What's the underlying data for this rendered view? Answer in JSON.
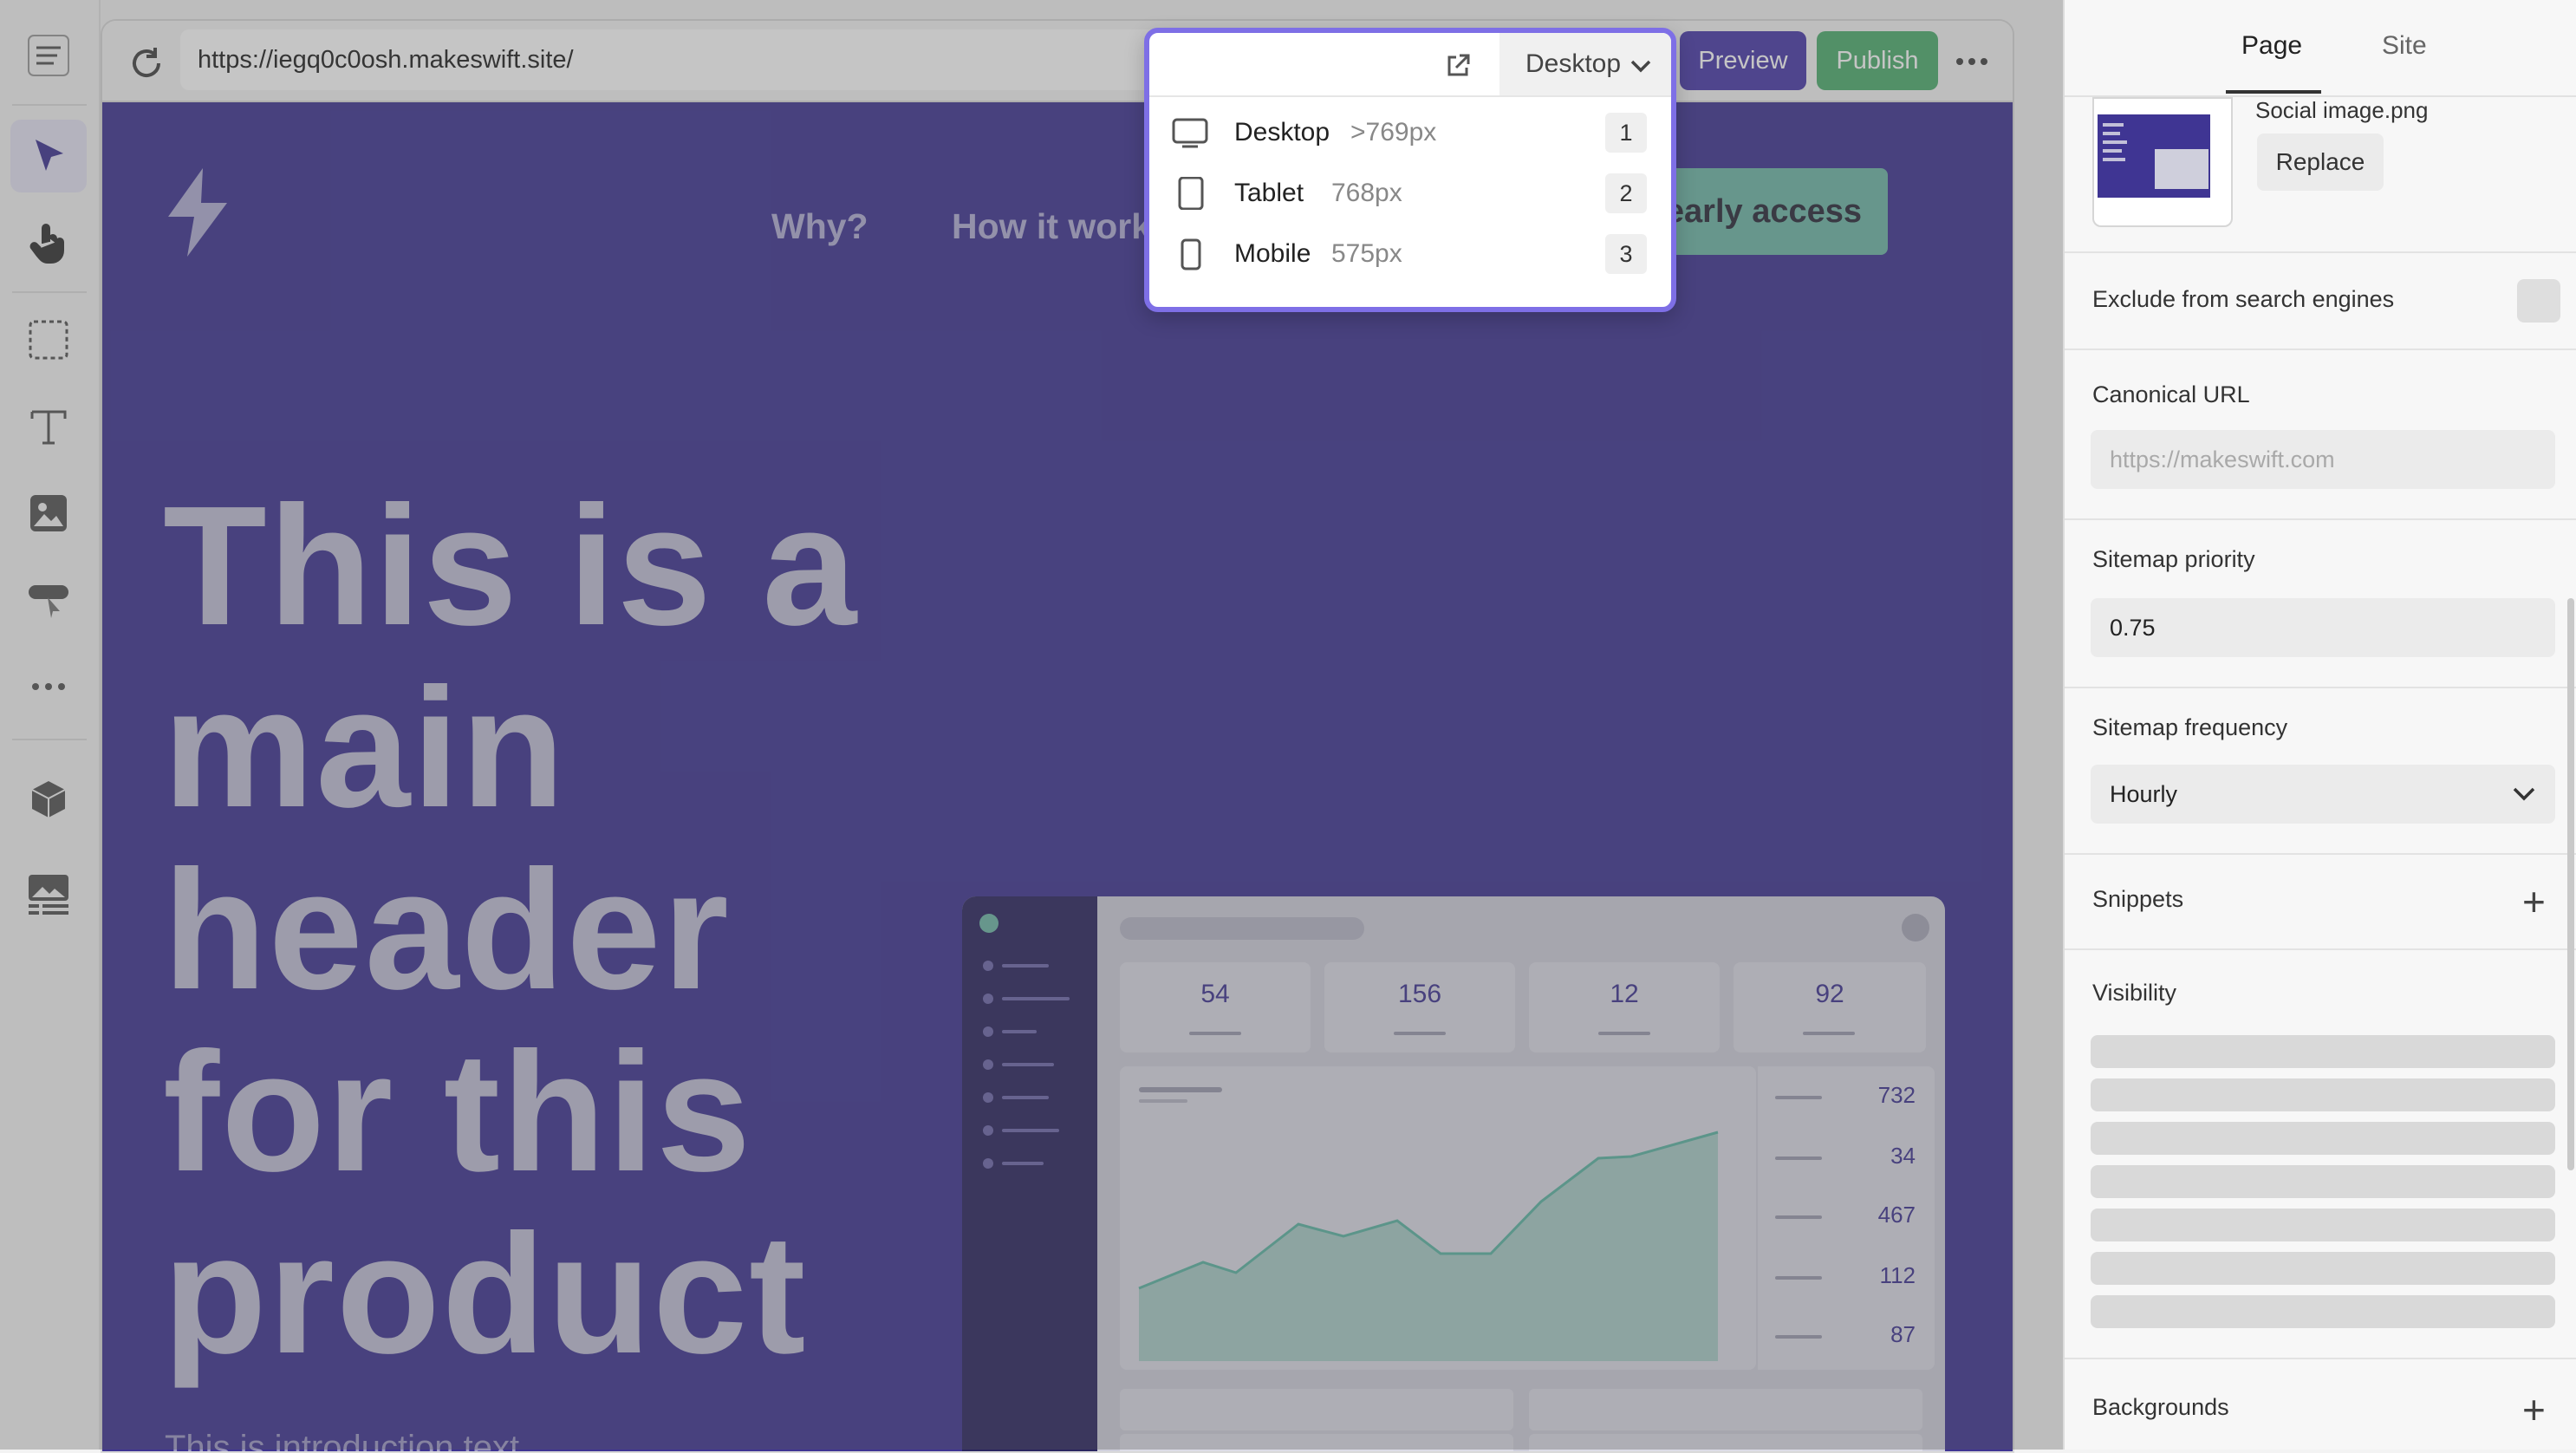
{
  "browser": {
    "url": "https://iegq0c0osh.makeswift.site/",
    "preview_label": "Preview",
    "publish_label": "Publish"
  },
  "site": {
    "nav": [
      "Why?",
      "How it work"
    ],
    "cta_label": "Get early access",
    "headline": "This is a main header for this product",
    "intro": "This is introduction text",
    "dashboard": {
      "stats": [
        "54",
        "156",
        "12",
        "92"
      ],
      "metrics": [
        "732",
        "34",
        "467",
        "112",
        "87"
      ]
    }
  },
  "device_menu": {
    "selected": "Desktop",
    "items": [
      {
        "label": "Desktop",
        "size": ">769px",
        "key": "1"
      },
      {
        "label": "Tablet",
        "size": "768px",
        "key": "2"
      },
      {
        "label": "Mobile",
        "size": "575px",
        "key": "3"
      }
    ]
  },
  "panel": {
    "tabs": [
      "Page",
      "Site"
    ],
    "active_tab": "Page",
    "social_image": {
      "filename": "Social image.png",
      "replace_label": "Replace"
    },
    "exclude_label": "Exclude from search engines",
    "canonical": {
      "label": "Canonical URL",
      "placeholder": "https://makeswift.com"
    },
    "sitemap_priority": {
      "label": "Sitemap priority",
      "value": "0.75"
    },
    "sitemap_frequency": {
      "label": "Sitemap frequency",
      "value": "Hourly"
    },
    "snippets_label": "Snippets",
    "visibility_label": "Visibility",
    "backgrounds_label": "Backgrounds"
  },
  "colors": {
    "accent": "#4a3ba9",
    "publish": "#4fae6f",
    "site_bg": "#3f3593",
    "teal": "#6fb7a8",
    "popover_border": "#7e6fe6"
  },
  "icons": {
    "rail": [
      "menu-icon",
      "select-arrow-icon",
      "hand-icon",
      "marquee-icon",
      "text-icon",
      "image-icon",
      "component-icon",
      "more-icon",
      "cube-icon",
      "gallery-icon"
    ]
  }
}
